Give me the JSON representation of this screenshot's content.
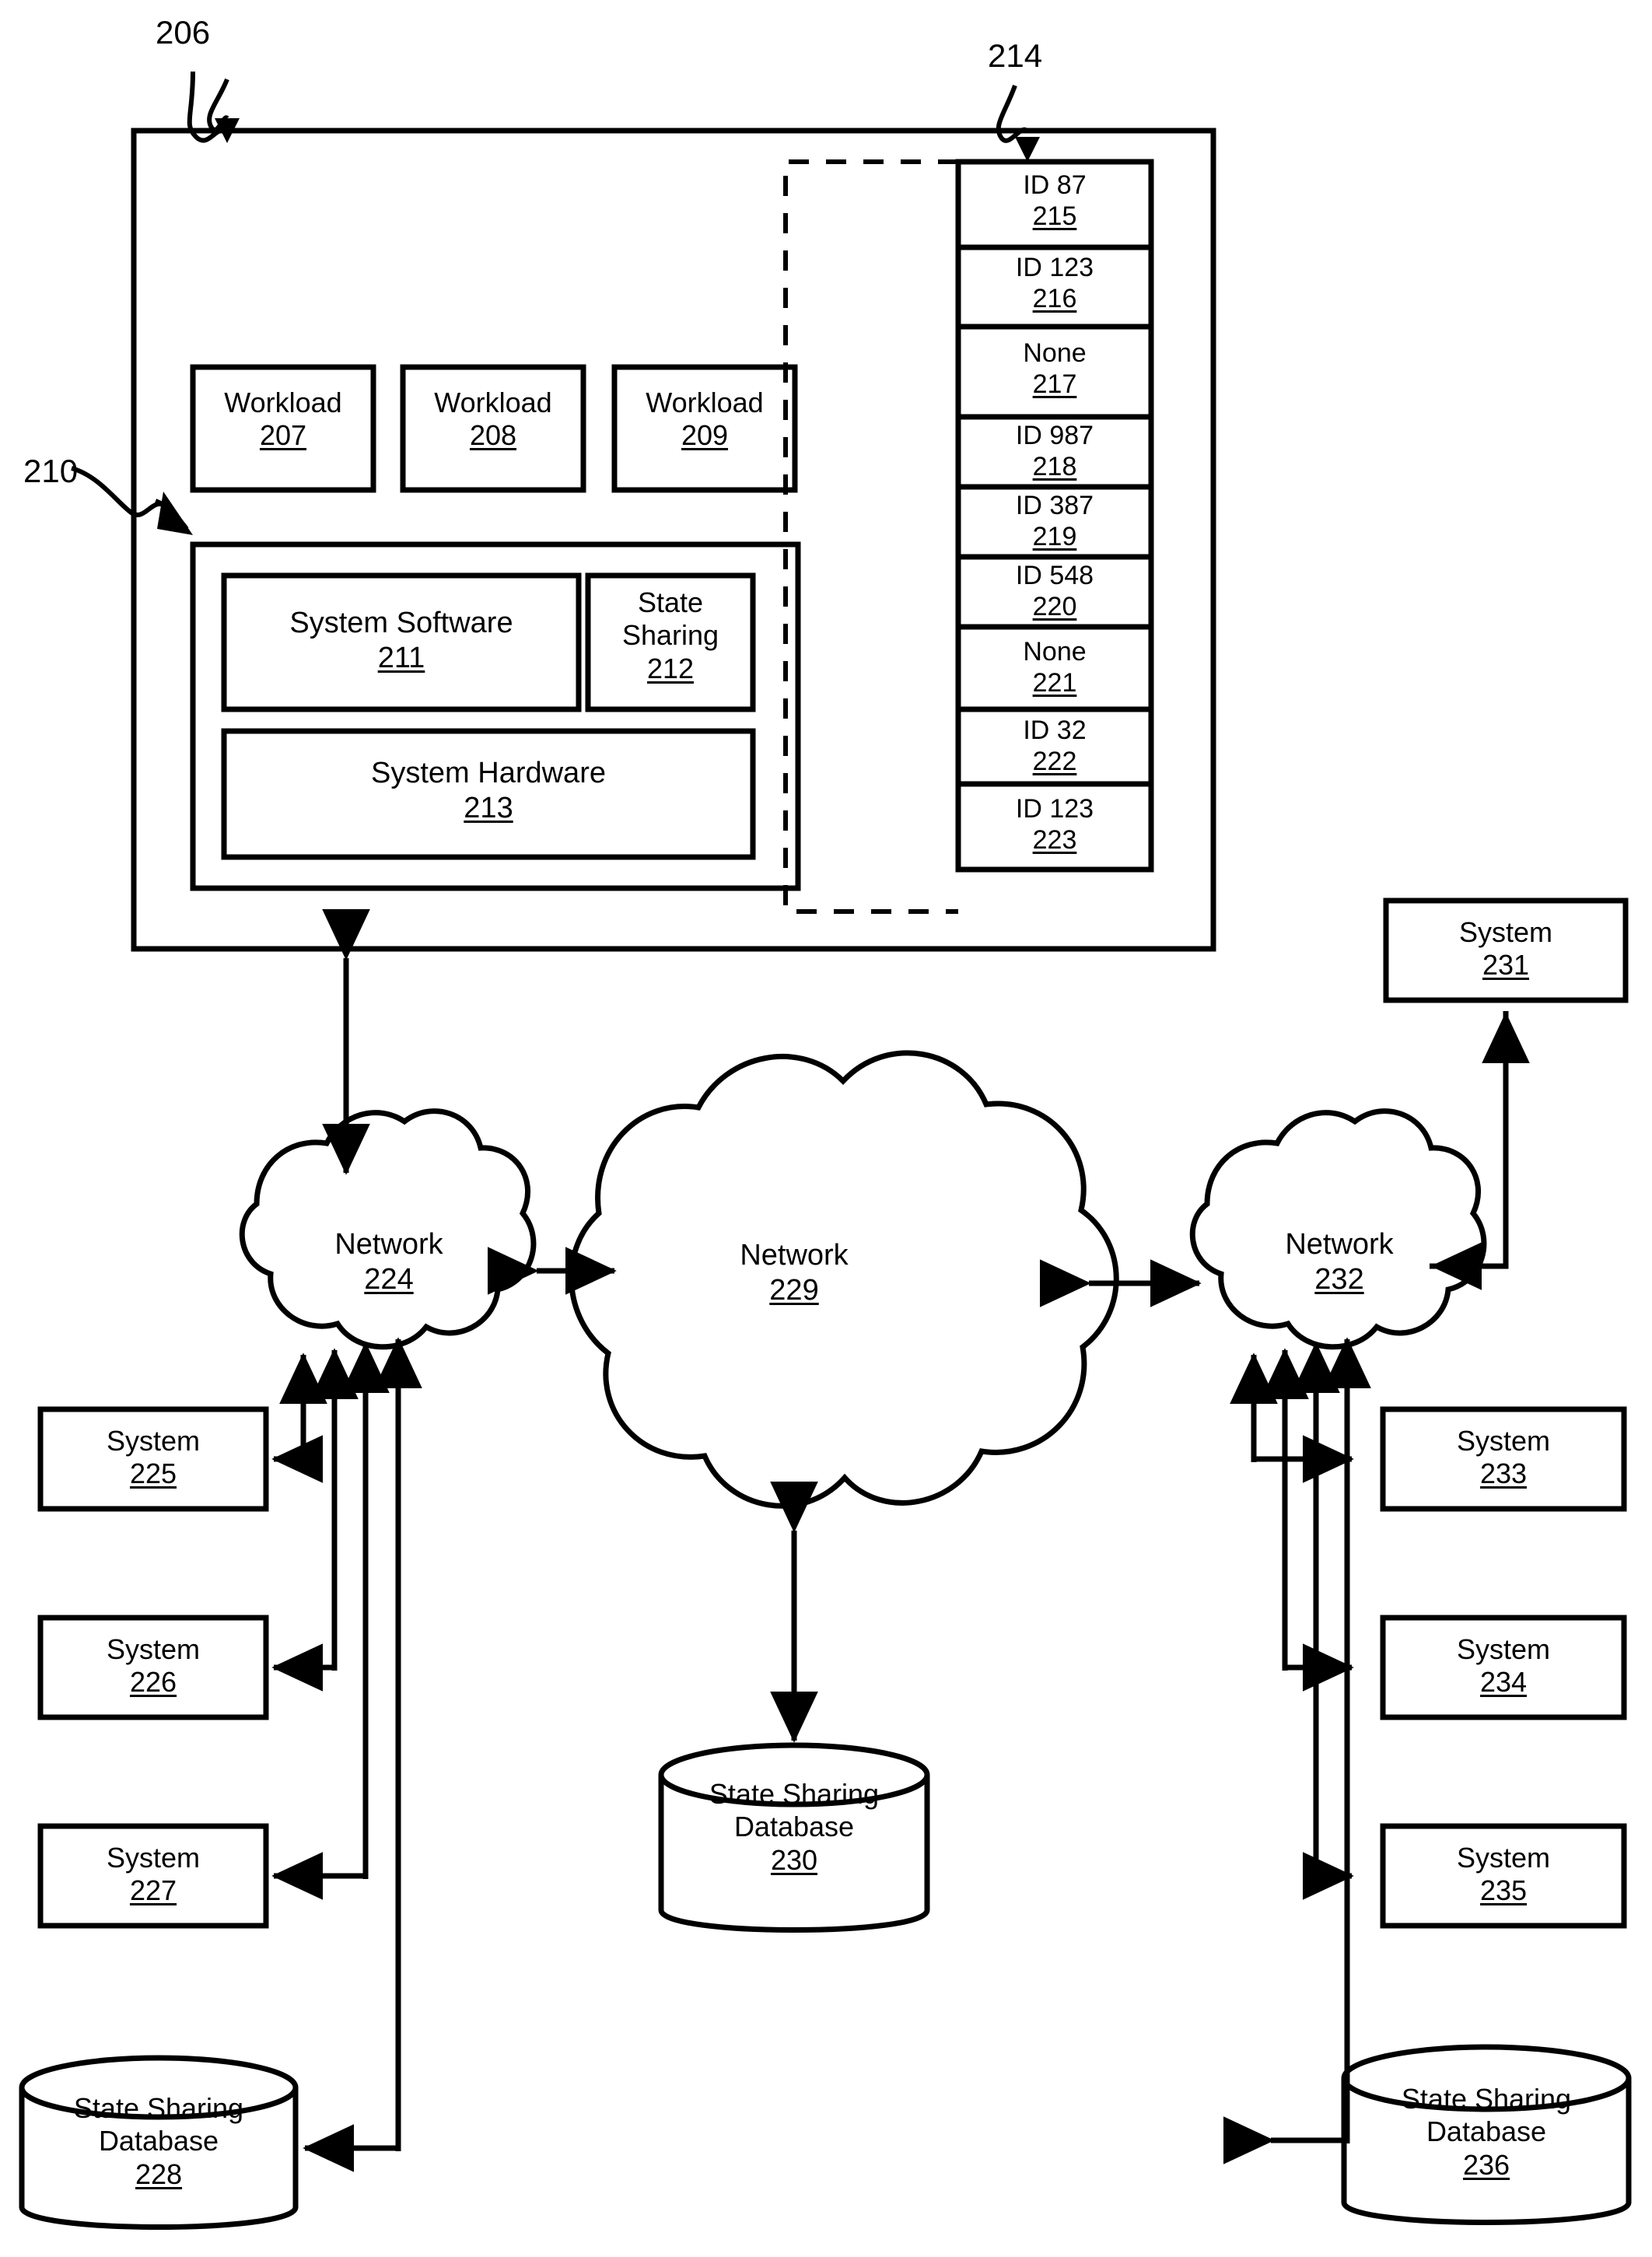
{
  "figure": {
    "type": "patent-diagram",
    "callouts": [
      {
        "name": "outer-system-callout",
        "number": "206"
      },
      {
        "name": "id-table-callout",
        "number": "214"
      },
      {
        "name": "platform-callout",
        "number": "210"
      }
    ]
  },
  "workloads": [
    {
      "label": "Workload",
      "ref": "207"
    },
    {
      "label": "Workload",
      "ref": "208"
    },
    {
      "label": "Workload",
      "ref": "209"
    }
  ],
  "platform": {
    "system_software": {
      "label": "System Software",
      "ref": "211"
    },
    "state_sharing": {
      "label_line1": "State",
      "label_line2": "Sharing",
      "ref": "212"
    },
    "system_hardware": {
      "label": "System Hardware",
      "ref": "213"
    }
  },
  "id_table": {
    "callout": "214",
    "rows": [
      {
        "value": "ID 87",
        "ref": "215"
      },
      {
        "value": "ID 123",
        "ref": "216"
      },
      {
        "value": "None",
        "ref": "217"
      },
      {
        "value": "ID 987",
        "ref": "218"
      },
      {
        "value": "ID 387",
        "ref": "219"
      },
      {
        "value": "ID 548",
        "ref": "220"
      },
      {
        "value": "None",
        "ref": "221"
      },
      {
        "value": "ID 32",
        "ref": "222"
      },
      {
        "value": "ID 123",
        "ref": "223"
      }
    ]
  },
  "networks": [
    {
      "label": "Network",
      "ref": "224"
    },
    {
      "label": "Network",
      "ref": "229"
    },
    {
      "label": "Network",
      "ref": "232"
    }
  ],
  "systems": [
    {
      "label": "System",
      "ref": "225"
    },
    {
      "label": "System",
      "ref": "226"
    },
    {
      "label": "System",
      "ref": "227"
    },
    {
      "label": "System",
      "ref": "231"
    },
    {
      "label": "System",
      "ref": "233"
    },
    {
      "label": "System",
      "ref": "234"
    },
    {
      "label": "System",
      "ref": "235"
    }
  ],
  "databases": [
    {
      "label_line1": "State Sharing",
      "label_line2": "Database",
      "ref": "228"
    },
    {
      "label_line1": "State Sharing",
      "label_line2": "Database",
      "ref": "230"
    },
    {
      "label_line1": "State Sharing",
      "label_line2": "Database",
      "ref": "236"
    }
  ],
  "colors": {
    "ink": "#000000",
    "paper": "#ffffff"
  }
}
